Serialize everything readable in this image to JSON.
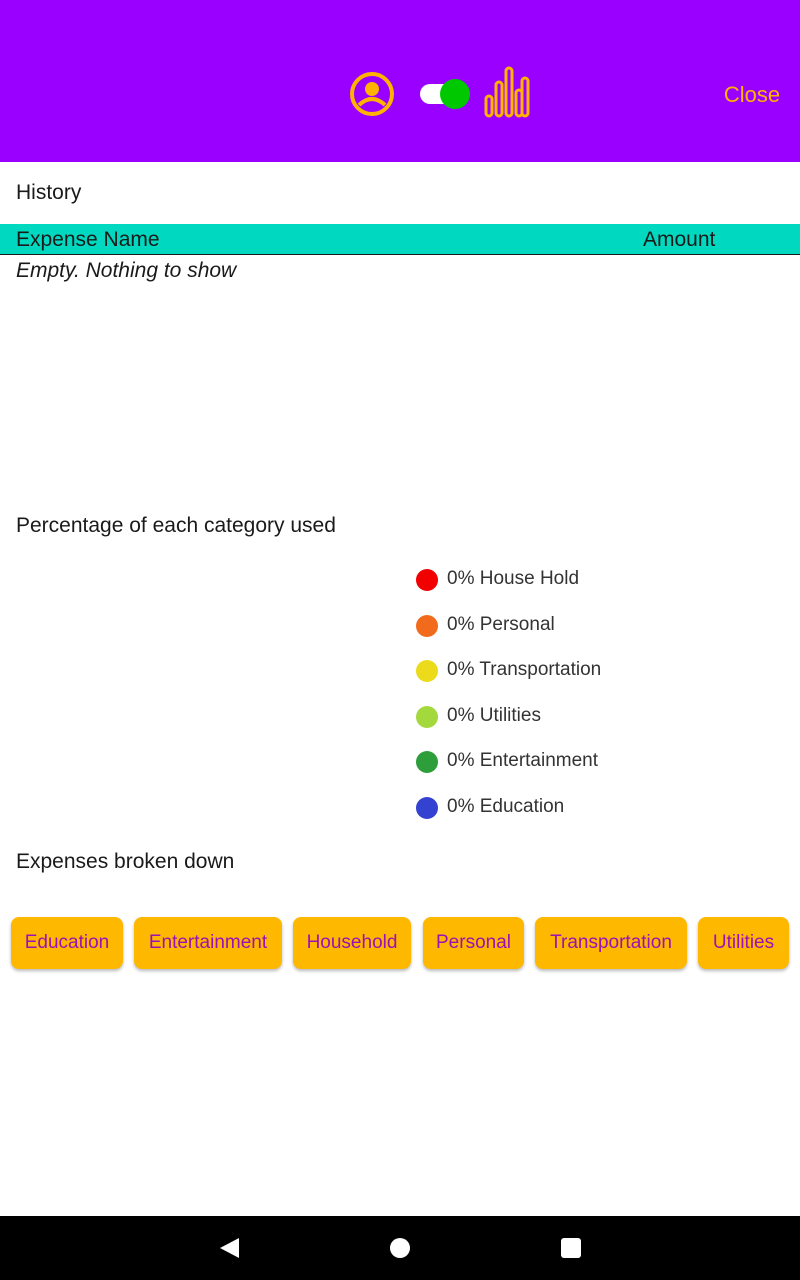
{
  "app_bar": {
    "background_color": "#9900ff",
    "accent_color": "#ffb300",
    "toggle_on_color": "#00c800",
    "icons": [
      "account-circle-icon",
      "bar-chart-icon"
    ],
    "toggle_state": "on",
    "close_label": "Close"
  },
  "history": {
    "heading": "History",
    "columns": {
      "name": "Expense Name",
      "amount": "Amount"
    },
    "header_color": "#00d9bf",
    "empty_text": "Empty. Nothing to show"
  },
  "percentages": {
    "heading": "Percentage of each category used",
    "legend": [
      {
        "label": "0% House Hold",
        "color": "#f20000"
      },
      {
        "label": "0% Personal",
        "color": "#f26b1d"
      },
      {
        "label": "0% Transportation",
        "color": "#ebdb1a"
      },
      {
        "label": "0% Utilities",
        "color": "#a3d93d"
      },
      {
        "label": "0% Entertainment",
        "color": "#2e9e3a"
      },
      {
        "label": "0% Education",
        "color": "#3342d1"
      }
    ]
  },
  "breakdown": {
    "heading": "Expenses broken down",
    "button_color": "#ffb800",
    "button_text_color": "#9c10b8",
    "buttons": [
      "Education",
      "Entertainment",
      "Household",
      "Personal",
      "Transportation",
      "Utilities"
    ]
  },
  "nav_bar": {
    "icons": [
      "back-icon",
      "home-icon",
      "recents-icon"
    ]
  }
}
